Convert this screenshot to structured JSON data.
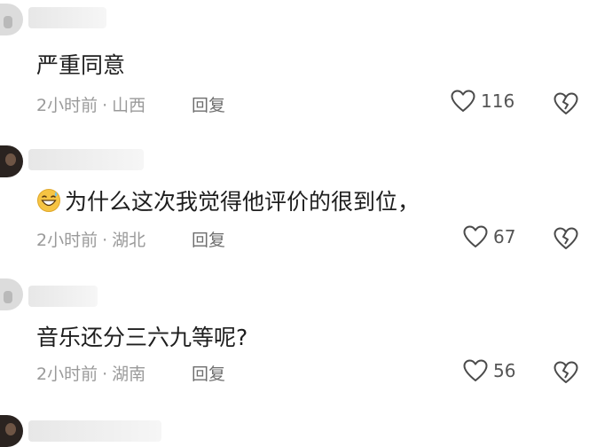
{
  "comments": [
    {
      "text": "严重同意",
      "time": "2小时前",
      "location": "山西",
      "reply_label": "回复",
      "likes": "116",
      "has_emoji": false
    },
    {
      "text": "为什么这次我觉得他评价的很到位，",
      "time": "2小时前",
      "location": "湖北",
      "reply_label": "回复",
      "likes": "67",
      "has_emoji": true,
      "emoji_icon": "grinning-sweat-emoji-icon"
    },
    {
      "text": "音乐还分三六九等呢?",
      "time": "2小时前",
      "location": "湖南",
      "reply_label": "回复",
      "likes": "56",
      "has_emoji": false
    }
  ],
  "meta_separator": "·",
  "icons": {
    "like": "heart-icon",
    "dislike": "broken-heart-icon"
  },
  "colors": {
    "text": "#1e1e1e",
    "meta": "#9a9a9a",
    "icon": "#4a4a4a"
  }
}
